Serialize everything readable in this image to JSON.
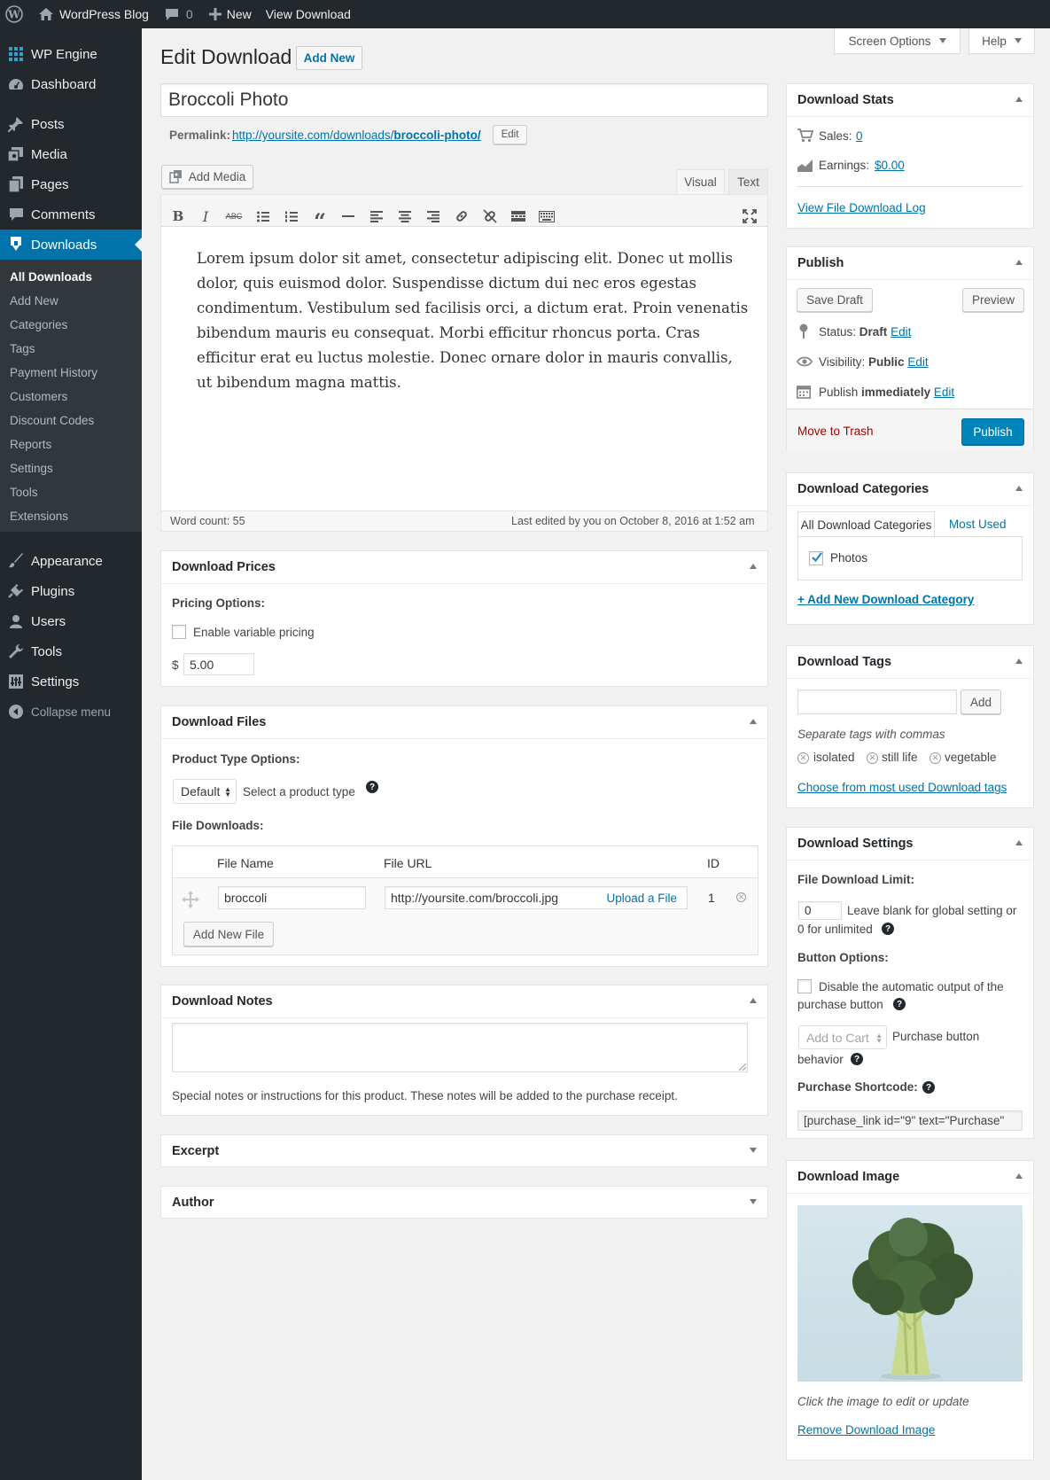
{
  "adminbar": {
    "site": "WordPress Blog",
    "comments": "0",
    "new": "New",
    "view": "View Download"
  },
  "menu": {
    "top": [
      {
        "label": "WP Engine"
      },
      {
        "label": "Dashboard"
      }
    ],
    "main": [
      {
        "label": "Posts"
      },
      {
        "label": "Media"
      },
      {
        "label": "Pages"
      },
      {
        "label": "Comments"
      },
      {
        "label": "Downloads"
      }
    ],
    "sub": [
      "All Downloads",
      "Add New",
      "Categories",
      "Tags",
      "Payment History",
      "Customers",
      "Discount Codes",
      "Reports",
      "Settings",
      "Tools",
      "Extensions"
    ],
    "bottom": [
      {
        "label": "Appearance"
      },
      {
        "label": "Plugins"
      },
      {
        "label": "Users"
      },
      {
        "label": "Tools"
      },
      {
        "label": "Settings"
      }
    ],
    "collapse": "Collapse menu"
  },
  "header": {
    "title": "Edit Download",
    "add_new": "Add New",
    "screen_options": "Screen Options",
    "help": "Help"
  },
  "post": {
    "title": "Broccoli Photo",
    "permalink_label": "Permalink:",
    "permalink_base": "http://yoursite.com/downloads/",
    "permalink_slug": "broccoli-photo/",
    "edit": "Edit"
  },
  "editor": {
    "add_media": "Add Media",
    "tab_visual": "Visual",
    "tab_text": "Text",
    "lines": [
      "Lorem ipsum dolor sit amet, consectetur adipiscing elit. Donec ut mollis",
      "dolor, quis euismod dolor. Suspendisse dictum dui nec eros egestas",
      "condimentum. Vestibulum sed facilisis orci, a dictum erat. Proin venenatis",
      "bibendum mauris eu consequat. Morbi efficitur rhoncus porta. Cras",
      "efficitur erat eu luctus molestie. Donec ornare dolor in mauris convallis,",
      "ut bibendum magna mattis."
    ],
    "word_count": "Word count: 55",
    "last_edited": "Last edited by you on October 8, 2016 at 1:52 am"
  },
  "prices": {
    "title": "Download Prices",
    "pricing_options": "Pricing Options:",
    "variable": "Enable variable pricing",
    "currency": "$",
    "price": "5.00"
  },
  "files": {
    "title": "Download Files",
    "product_type_label": "Product Type Options:",
    "type_value": "Default",
    "type_hint": "Select a product type",
    "file_downloads": "File Downloads:",
    "col_name": "File Name",
    "col_url": "File URL",
    "col_id": "ID",
    "file_name": "broccoli",
    "file_url": "http://yoursite.com/broccoli.jpg",
    "upload": "Upload a File",
    "file_id": "1",
    "add_new_file": "Add New File"
  },
  "notes": {
    "title": "Download Notes",
    "hint": "Special notes or instructions for this product. These notes will be added to the purchase receipt."
  },
  "excerpt": {
    "title": "Excerpt"
  },
  "author": {
    "title": "Author"
  },
  "stats": {
    "title": "Download Stats",
    "sales_label": "Sales:",
    "sales": "0",
    "earnings_label": "Earnings:",
    "earnings": "$0.00",
    "log": "View File Download Log"
  },
  "publish": {
    "title": "Publish",
    "save_draft": "Save Draft",
    "preview": "Preview",
    "status_label": "Status:",
    "status": "Draft",
    "visibility_label": "Visibility:",
    "visibility": "Public",
    "publish_label": "Publish",
    "publish_when": "immediately",
    "edit": "Edit",
    "trash": "Move to Trash",
    "publish_btn": "Publish"
  },
  "categories": {
    "title": "Download Categories",
    "tab_all": "All Download Categories",
    "tab_used": "Most Used",
    "item": "Photos",
    "add": "+ Add New Download Category"
  },
  "tags": {
    "title": "Download Tags",
    "add": "Add",
    "hint": "Separate tags with commas",
    "list": [
      "isolated",
      "still life",
      "vegetable"
    ],
    "choose": "Choose from most used Download tags"
  },
  "settings": {
    "title": "Download Settings",
    "limit_label": "File Download Limit:",
    "limit_value": "0",
    "limit_hint_1": "Leave blank for global setting or",
    "limit_hint_2": "0 for unlimited",
    "button_options": "Button Options:",
    "disable_1": "Disable the automatic output of the",
    "disable_2": "purchase button",
    "behavior_select": "Add to Cart",
    "behavior_1": "Purchase button",
    "behavior_2": "behavior",
    "shortcode_label": "Purchase Shortcode:",
    "shortcode": "[purchase_link id=\"9\" text=\"Purchase\""
  },
  "image": {
    "title": "Download Image",
    "hint": "Click the image to edit or update",
    "remove": "Remove Download Image"
  },
  "colors": {
    "bar": "#23282d",
    "accent": "#0073aa",
    "link": "#0073aa",
    "trash": "#a00"
  }
}
